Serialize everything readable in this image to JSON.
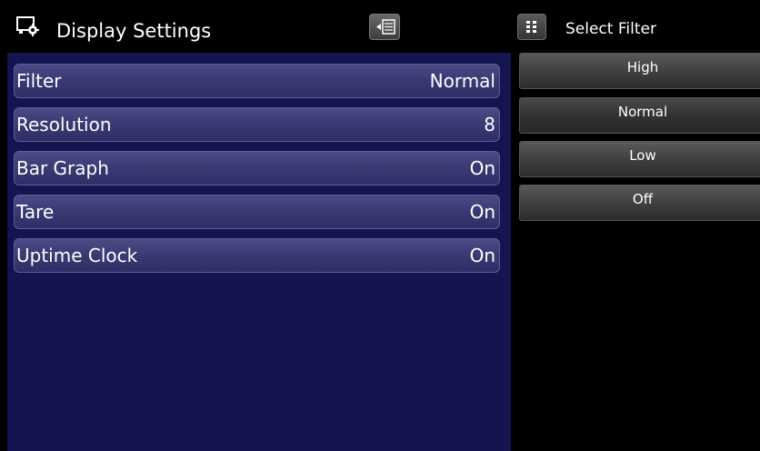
{
  "left": {
    "title": "Display Settings",
    "icons": {
      "header": "display-settings-icon",
      "collapse": "collapse-menu-icon"
    },
    "rows": [
      {
        "label": "Filter",
        "value": "Normal"
      },
      {
        "label": "Resolution",
        "value": "8"
      },
      {
        "label": "Bar Graph",
        "value": "On"
      },
      {
        "label": "Tare",
        "value": "On"
      },
      {
        "label": "Uptime Clock",
        "value": "On"
      }
    ]
  },
  "right": {
    "title": "Select Filter",
    "icon": "grid-dots-icon",
    "options": [
      {
        "label": "High"
      },
      {
        "label": "Normal"
      },
      {
        "label": "Low"
      },
      {
        "label": "Off"
      }
    ],
    "selected": "Normal"
  },
  "colors": {
    "panel_bg": "#131450",
    "row_top": "#4b4c86",
    "row_bottom": "#2e2f66",
    "option_bg": "#404040"
  }
}
